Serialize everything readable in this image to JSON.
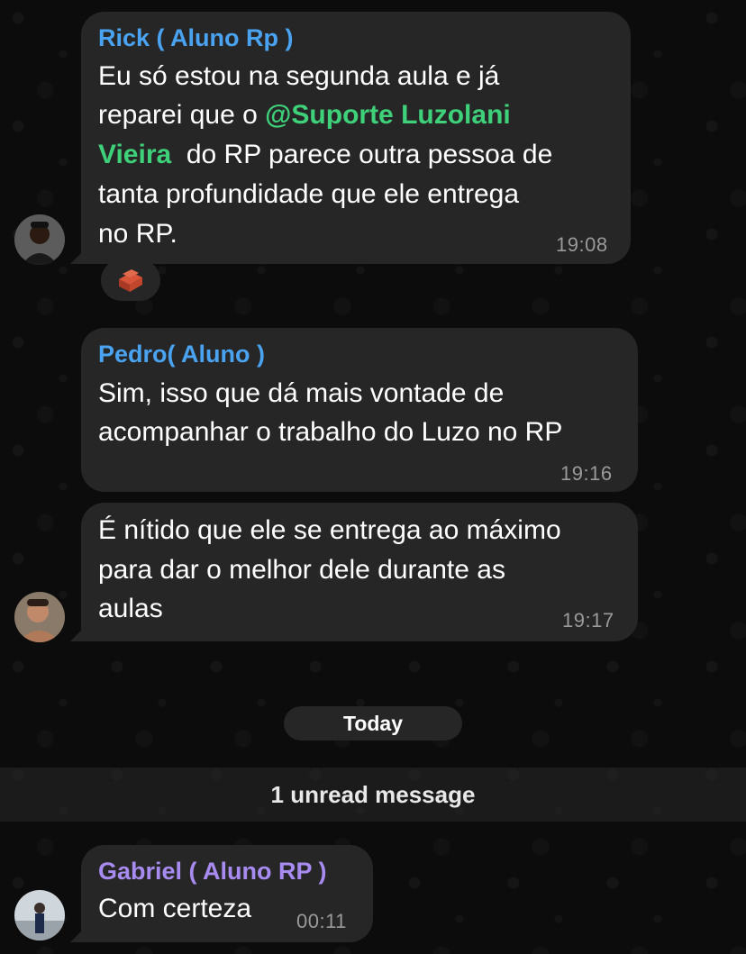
{
  "messages": [
    {
      "sender": "Rick ( Aluno Rp )",
      "sender_color": "#4aa3f0",
      "lines": [
        "Eu só estou na segunda aula e já",
        "reparei que o "
      ],
      "mention": {
        "prefix": "@",
        "line1": "Suporte Luzolani",
        "line2": "Vieira"
      },
      "after_mention": "  do RP parece outra pessoa de",
      "lines_after": [
        "tanta profundidade que ele entrega",
        "no RP."
      ],
      "time": "19:08",
      "reaction": "brick-emoji"
    },
    {
      "sender": "Pedro( Aluno )",
      "sender_color": "#4aa3f0",
      "lines": [
        "Sim, isso que dá mais vontade de",
        "acompanhar o trabalho do Luzo no RP"
      ],
      "time": "19:16"
    },
    {
      "lines": [
        "É nítido que ele se entrega ao máximo",
        "para dar o melhor dele durante as",
        "aulas"
      ],
      "time": "19:17"
    },
    {
      "sender": "Gabriel ( Aluno RP )",
      "sender_color": "#a78bf0",
      "lines": [
        "Com certeza"
      ],
      "time": "00:11"
    }
  ],
  "date_separator": "Today",
  "unread_label": "1 unread message"
}
